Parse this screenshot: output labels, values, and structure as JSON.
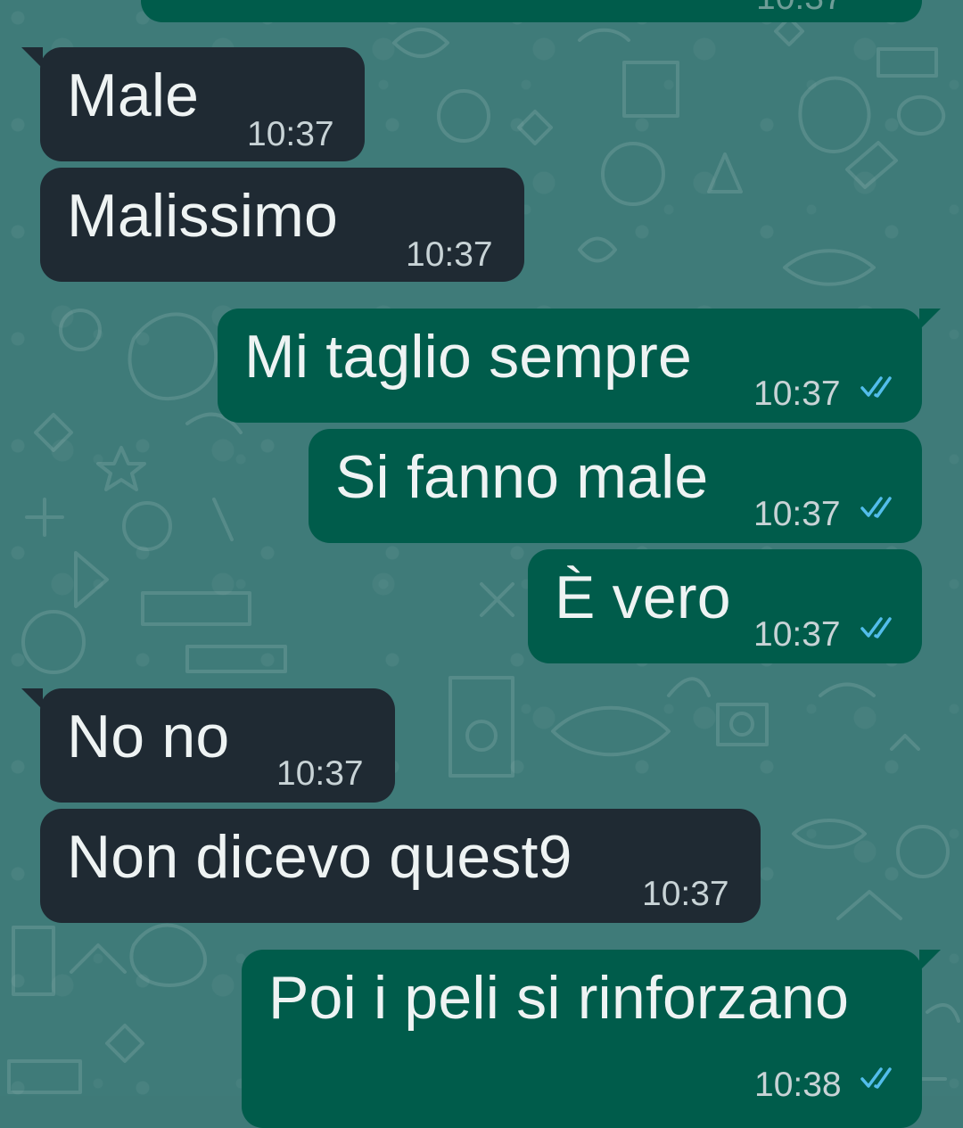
{
  "theme": {
    "wallpaper": "#3f7b79",
    "incoming_bubble": "#1f2a33",
    "outgoing_bubble": "#005c4b",
    "text_color": "#eef3f3",
    "read_receipt_color": "#53bdeb"
  },
  "conversation": {
    "messages": [
      {
        "text": "Male",
        "time": "10:37",
        "direction": "incoming"
      },
      {
        "text": "Malissimo",
        "time": "10:37",
        "direction": "incoming"
      },
      {
        "text": "Mi taglio sempre",
        "time": "10:37",
        "direction": "outgoing",
        "status": "double-check-read-icon"
      },
      {
        "text": "Si fanno male",
        "time": "10:37",
        "direction": "outgoing",
        "status": "double-check-read-icon"
      },
      {
        "text": "È vero",
        "time": "10:37",
        "direction": "outgoing",
        "status": "double-check-read-icon"
      },
      {
        "text": "No no",
        "time": "10:37",
        "direction": "incoming"
      },
      {
        "text": "Non dicevo quest9",
        "time": "10:37",
        "direction": "incoming"
      },
      {
        "text": "Poi i peli si rinforzano",
        "time": "10:38",
        "direction": "outgoing",
        "status": "double-check-read-icon"
      }
    ]
  }
}
